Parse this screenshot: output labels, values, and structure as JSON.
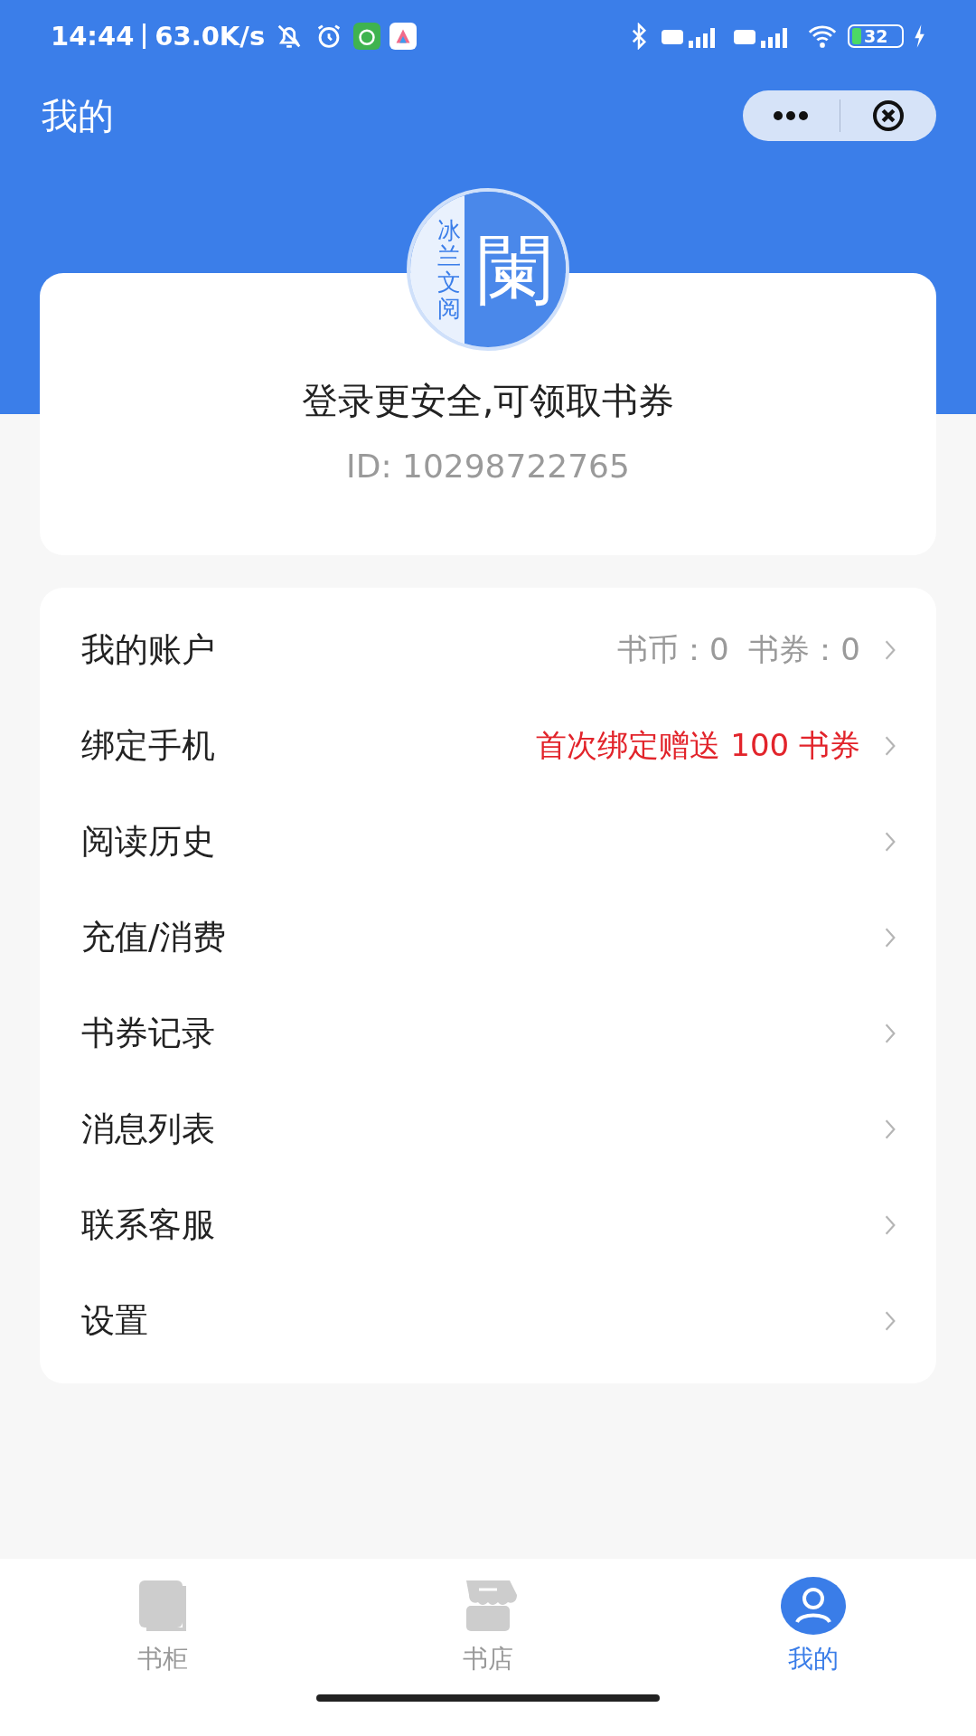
{
  "status_bar": {
    "time": "14:44",
    "speed": "63.0K/s",
    "battery": "32"
  },
  "header": {
    "title": "我的"
  },
  "profile": {
    "logo_side_text": "冰兰文阅",
    "logo_main_text": "闌",
    "prompt": "登录更安全,可领取书券",
    "user_id": "ID: 10298722765"
  },
  "menu": [
    {
      "label": "我的账户",
      "kind": "balance",
      "detail": "书币：0  书券：0"
    },
    {
      "label": "绑定手机",
      "kind": "promo",
      "detail": "首次绑定赠送 100 书券"
    },
    {
      "label": "阅读历史",
      "kind": "plain"
    },
    {
      "label": "充值/消费",
      "kind": "plain"
    },
    {
      "label": "书券记录",
      "kind": "plain"
    },
    {
      "label": "消息列表",
      "kind": "plain"
    },
    {
      "label": "联系客服",
      "kind": "plain"
    },
    {
      "label": "设置",
      "kind": "plain"
    }
  ],
  "tab_bar": [
    {
      "label": "书柜",
      "kind": "book",
      "selected": false
    },
    {
      "label": "书店",
      "kind": "store",
      "selected": false
    },
    {
      "label": "我的",
      "kind": "person",
      "selected": true
    }
  ]
}
